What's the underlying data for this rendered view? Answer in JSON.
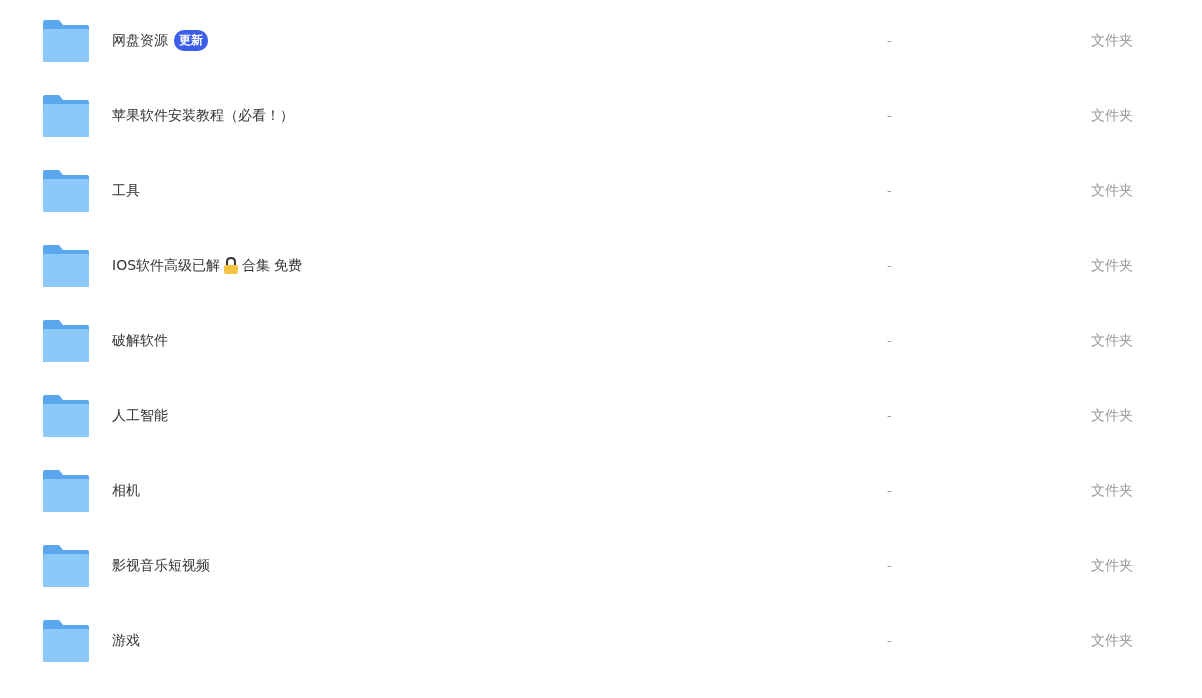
{
  "files": [
    {
      "kind": "plain",
      "name": "网盘资源",
      "badge": "更新",
      "size": "-",
      "type": "文件夹"
    },
    {
      "kind": "plain",
      "name": "苹果软件安装教程（必看！）",
      "size": "-",
      "type": "文件夹"
    },
    {
      "kind": "plain",
      "name": "工具",
      "size": "-",
      "type": "文件夹"
    },
    {
      "kind": "iconic",
      "name": "IOS软件高级已解",
      "suffix": "合集 免费",
      "size": "-",
      "type": "文件夹"
    },
    {
      "kind": "plain",
      "name": "破解软件",
      "size": "-",
      "type": "文件夹"
    },
    {
      "kind": "plain",
      "name": "人工智能",
      "size": "-",
      "type": "文件夹"
    },
    {
      "kind": "plain",
      "name": "相机",
      "size": "-",
      "type": "文件夹"
    },
    {
      "kind": "plain",
      "name": "影视音乐短视频",
      "size": "-",
      "type": "文件夹"
    },
    {
      "kind": "plain",
      "name": "游戏",
      "size": "-",
      "type": "文件夹"
    }
  ]
}
